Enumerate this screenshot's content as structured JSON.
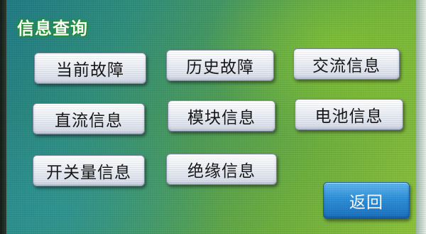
{
  "title": "信息查询",
  "buttons": {
    "current_faults": "当前故障",
    "history_faults": "历史故障",
    "ac_info": "交流信息",
    "dc_info": "直流信息",
    "module_info": "模块信息",
    "battery_info": "电池信息",
    "switch_info": "开关量信息",
    "insulation_info": "绝缘信息",
    "back": "返回"
  },
  "colors": {
    "title_glow": "#2aa63a",
    "button_face": "#eef1f7",
    "back_button": "#2c8fd8",
    "background_start": "#1f7a86",
    "background_end": "#8ec33a"
  }
}
